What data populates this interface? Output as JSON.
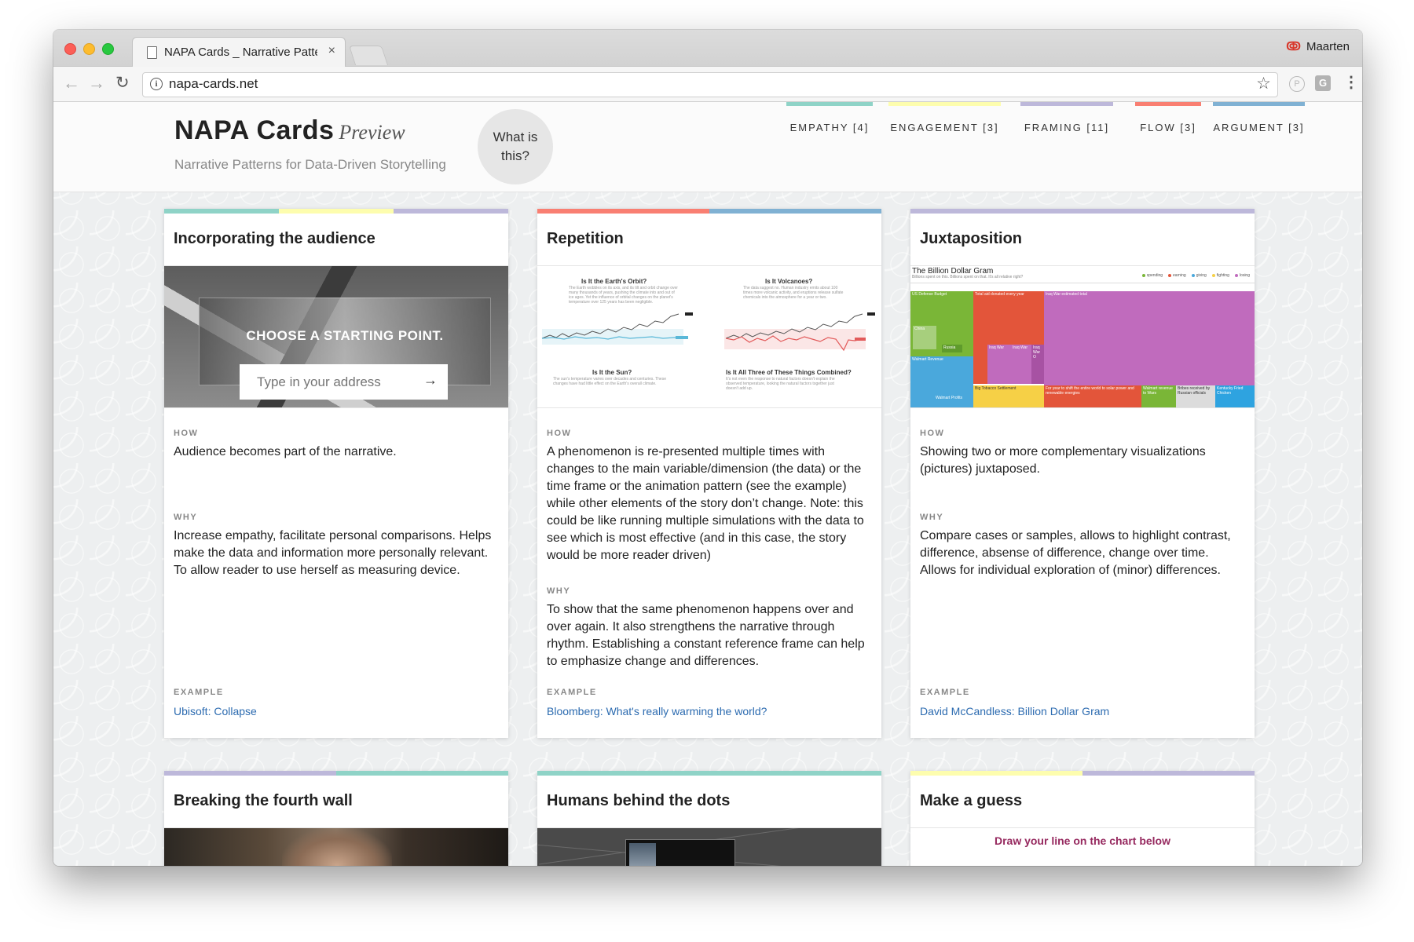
{
  "browser": {
    "tab_title": "NAPA Cards _ Narrative Patterns for Data-Driven Storytelling",
    "tab_close": "×",
    "url": "napa-cards.net",
    "profile_name": "Maarten",
    "back_icon": "←",
    "forward_icon": "→",
    "reload_icon": "↻",
    "star_icon": "☆",
    "ext_p": "P",
    "ext_g": "G",
    "menu_icon": "⋮"
  },
  "header": {
    "title": "NAPA Cards",
    "title_sub": "Preview",
    "tagline": "Narrative Patterns for Data-Driven Storytelling",
    "whatis": "What is this?"
  },
  "nav": [
    {
      "label": "EMPATHY [4]",
      "color": "#8fd3c7"
    },
    {
      "label": "ENGAGEMENT [3]",
      "color": "#fdfdae"
    },
    {
      "label": "FRAMING [11]",
      "color": "#bdb8da"
    },
    {
      "label": "FLOW [3]",
      "color": "#f97f72"
    },
    {
      "label": "ARGUMENT [3]",
      "color": "#80b1d3"
    }
  ],
  "cards": [
    {
      "title": "Incorporating the audience",
      "bar": [
        "#8fd3c7",
        "#fdfdae",
        "#bdb8da"
      ],
      "how_label": "HOW",
      "how": "Audience becomes part of the narrative.",
      "why_label": "WHY",
      "why": "Increase empathy, facilitate personal comparisons. Helps make the data and information more personally relevant. To allow reader to use herself as measuring device.",
      "example_label": "EXAMPLE",
      "example": "Ubisoft: Collapse",
      "img": {
        "choose": "CHOOSE A STARTING POINT.",
        "address_placeholder": "Type in your address",
        "arrow": "→"
      }
    },
    {
      "title": "Repetition",
      "bar": [
        "#f97f72",
        "#80b1d3"
      ],
      "how_label": "HOW",
      "how": "A phenomenon is re-presented multiple times with changes to the main variable/dimension (the data) or the time frame or the animation pattern (see the example) while other elements of the story don’t change. Note: this could be like running multiple simulations with the data to see which is most effective (and in this case, the story would be more reader driven)",
      "why_label": "WHY",
      "why": "To show that the same phenomenon happens over and over again. It also strengthens the narrative through rhythm. Establishing a constant reference frame can help to emphasize change and differences.",
      "example_label": "EXAMPLE",
      "example": "Bloomberg: What's really warming the world?",
      "img": {
        "q1": "Is It the Earth's Orbit?",
        "q2": "Is It Volcanoes?",
        "q3": "Is It the Sun?",
        "q4": "Is It All Three of These Things Combined?",
        "q1_sub": "The Earth wobbles on its axis, and its tilt and orbit change over many thousands of years, pushing the climate into and out of ice ages. Yet the influence of orbital changes on the planet's temperature over 125 years has been negligible.",
        "q2_sub": "The data suggest no. Human industry emits about 100 times more volcanic activity, and eruptions release sulfate chemicals into the atmosphere for a year or two.",
        "q3_sub": "The sun's temperature varies over decades and centuries. These changes have had little effect on the Earth's overall climate.",
        "q4_sub": "It's not even the response to natural factors doesn't explain the observed temperature, looking the natural factors together just doesn't add up."
      }
    },
    {
      "title": "Juxtaposition",
      "bar": [
        "#bdb8da"
      ],
      "how_label": "HOW",
      "how": "Showing two or more complementary visualizations (pictures) juxtaposed.",
      "why_label": "WHY",
      "why": "Compare cases or samples, allows to highlight contrast, difference, absense of difference, change over time. Allows for individual exploration of (minor) differences.",
      "example_label": "EXAMPLE",
      "example": "David McCandless: Billion Dollar Gram",
      "img": {
        "title": "The Billion Dollar Gram",
        "subtitle": "Billions spent on this. Billions spent on that. It's all relative right?",
        "legend": [
          {
            "label": "spending",
            "color": "#7ab637"
          },
          {
            "label": "earning",
            "color": "#e3553a"
          },
          {
            "label": "giving",
            "color": "#4aa8dc"
          },
          {
            "label": "fighting",
            "color": "#f6d046"
          },
          {
            "label": "losing",
            "color": "#c06bbd"
          }
        ],
        "blocks": {
          "a": "US Defense Budget",
          "b": "Total aid donated every year",
          "c": "Iraq War estimated total",
          "d": "China",
          "e": "Russia",
          "f": "Walmart Revenue",
          "g": "Walmart Profits",
          "h": "Big Tobacco Settlement",
          "i": "Iraq War",
          "j": "Iraq War",
          "k": "Iraq War O",
          "l": "For year to shift the entire world to solar power and renewable energies",
          "m": "Walmart revenue to Wars",
          "n": "Bribes received by Russian officials",
          "o": "Kentucky Fried Chicken"
        }
      }
    },
    {
      "title": "Breaking the fourth wall",
      "bar": [
        "#bdb8da",
        "#8fd3c7"
      ]
    },
    {
      "title": "Humans behind the dots",
      "bar": [
        "#8fd3c7"
      ]
    },
    {
      "title": "Make a guess",
      "bar": [
        "#fdfdae",
        "#bdb8da"
      ],
      "img": {
        "text": "Draw your line on the chart below"
      }
    }
  ]
}
